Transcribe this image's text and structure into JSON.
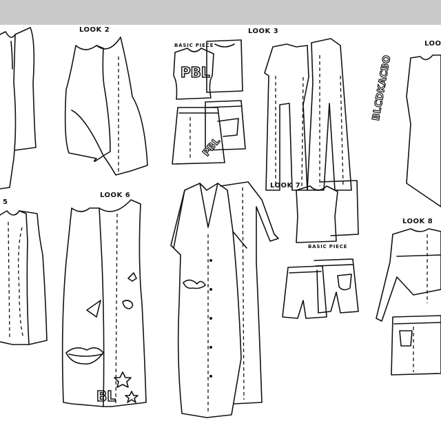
{
  "sheet": {
    "looks": [
      {
        "label": "LOOK 2"
      },
      {
        "label": "LOOK 3"
      },
      {
        "label": "LOOK 6"
      },
      {
        "label": "LOOK 7"
      },
      {
        "label": "LOOK 8"
      },
      {
        "label": "5"
      },
      {
        "label": "LOOK"
      }
    ],
    "basic_piece_top": "BASIC PIECE",
    "basic_piece_l7": "BASIC PIECE",
    "tee_print": "PBL",
    "skirt_print": "PBL",
    "bl_print": "BL",
    "side_print": "BLCDKACBO"
  }
}
